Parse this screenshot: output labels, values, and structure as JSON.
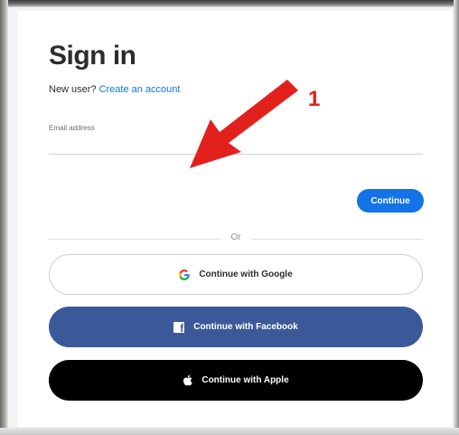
{
  "signin": {
    "title": "Sign in",
    "new_user_text": "New user?",
    "create_account_link": "Create an account",
    "email_label": "Email address",
    "email_value": "",
    "continue_label": "Continue",
    "divider_text": "Or",
    "google_label": "Continue with Google",
    "facebook_label": "Continue with Facebook",
    "apple_label": "Continue with Apple"
  },
  "annotation": {
    "number": "1",
    "arrow_color": "#e2211c"
  },
  "colors": {
    "accent_blue": "#1473e6",
    "facebook_blue": "#3b5998",
    "apple_black": "#000000"
  },
  "icons": {
    "google": "google-icon",
    "facebook": "facebook-icon",
    "apple": "apple-icon",
    "arrow": "arrow-icon"
  }
}
